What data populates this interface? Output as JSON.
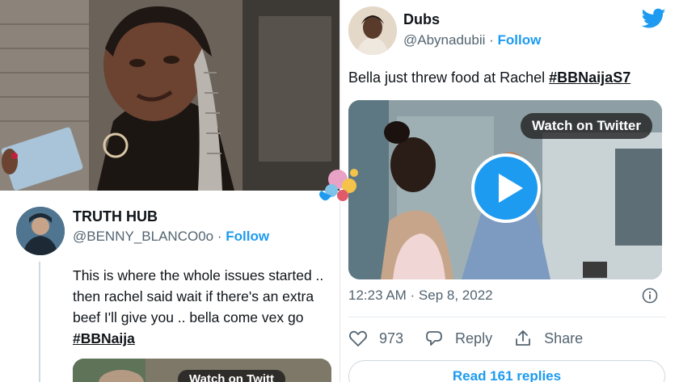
{
  "left_tweet": {
    "name": "TRUTH HUB",
    "handle": "@BENNY_BLANCO0o",
    "separator": "·",
    "follow_label": "Follow",
    "text": "This is where the whole issues started .. then rachel said wait if there's an extra beef I'll give you .. bella come vex go",
    "hashtag": "#BBNaija",
    "video_watch_label": "Watch on Twitt"
  },
  "right_tweet": {
    "name": "Dubs",
    "handle": "@Abynadubii",
    "separator": "·",
    "follow_label": "Follow",
    "text": "Bella just threw food at Rachel",
    "hashtag": "#BBNaijaS7",
    "video_watch_label": "Watch on Twitter",
    "timestamp": "12:23 AM · Sep 8, 2022",
    "likes_count": "973",
    "reply_label": "Reply",
    "share_label": "Share",
    "read_replies_label": "Read 161 replies"
  },
  "colors": {
    "accent": "#1d9bf0",
    "text_primary": "#0f1419",
    "text_secondary": "#536471",
    "border": "#cfd9de"
  },
  "icons": [
    "twitter-bird-icon",
    "play-icon",
    "info-icon",
    "heart-icon",
    "reply-icon",
    "share-icon"
  ]
}
